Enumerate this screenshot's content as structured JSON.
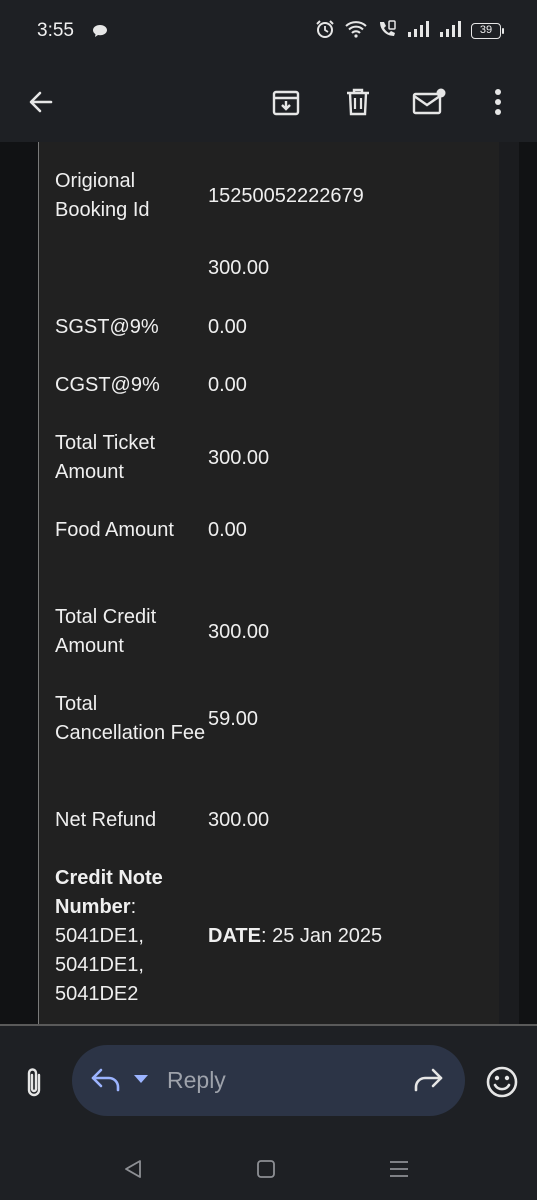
{
  "status_bar": {
    "time": "3:55",
    "battery": "39",
    "icons": [
      "chat-bubble-icon",
      "alarm-icon",
      "wifi-icon",
      "wifi-call-icon",
      "signal-icon",
      "signal-icon",
      "battery-icon"
    ]
  },
  "toolbar": {
    "back_icon": "arrow-back-icon",
    "archive_icon": "archive-icon",
    "delete_icon": "trash-icon",
    "mark_unread_icon": "mail-unread-icon",
    "more_icon": "more-vertical-icon"
  },
  "email": {
    "rows": [
      {
        "label": "Origional Booking Id",
        "value": "15250052222679"
      },
      {
        "label": "",
        "value": "300.00"
      },
      {
        "label": "SGST@9%",
        "value": "0.00"
      },
      {
        "label": "CGST@9%",
        "value": "0.00"
      },
      {
        "label": "Total Ticket Amount",
        "value": "300.00"
      },
      {
        "label": "Food Amount",
        "value": "0.00"
      },
      {
        "label": "Total Credit Amount",
        "value": "300.00"
      },
      {
        "label": "Total Cancellation Fee",
        "value": "59.00"
      },
      {
        "label": "Net Refund",
        "value": "300.00"
      }
    ],
    "credit_note": {
      "label": "Credit Note Number",
      "colon": ":",
      "values": "5041DE1, 5041DE1, 5041DE2",
      "date_label": "DATE",
      "date_value": ": 25 Jan 2025"
    }
  },
  "reply_bar": {
    "placeholder": "Reply",
    "attach_icon": "paperclip-icon",
    "reply_icon": "reply-icon",
    "forward_icon": "forward-icon",
    "emoji_icon": "emoji-icon"
  },
  "nav_bar": {
    "back": "nav-back-icon",
    "home": "nav-home-icon",
    "recents": "nav-recents-icon"
  },
  "colors": {
    "background": "#111214",
    "card": "#212121",
    "bars": "#1e2024",
    "reply_pill": "#2c3446",
    "accent": "#9cb4ff"
  }
}
